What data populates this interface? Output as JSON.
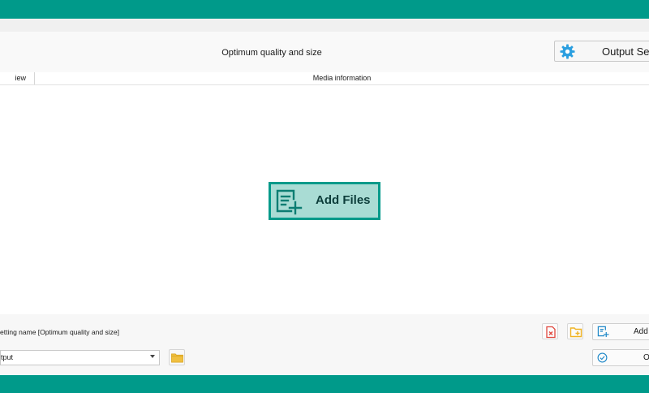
{
  "header": {
    "preset_label": "Optimum quality and size",
    "output_settings_label": "Output Setti"
  },
  "columns": {
    "preview": "iew",
    "media_info": "Media information"
  },
  "main": {
    "add_files_label": "Add Files"
  },
  "footer": {
    "setting_name": "etting name [Optimum quality and size]",
    "add_files_small_label": "Add F",
    "output_folder_value": "tput",
    "ok_label": "Ol"
  },
  "icons": {
    "output_settings": "gear-icon",
    "add_files": "add-file-icon",
    "delete": "delete-file-icon",
    "add_folder": "add-folder-icon",
    "browse": "folder-icon",
    "ok": "check-circle-icon",
    "dropdown": "chevron-down-icon"
  },
  "colors": {
    "accent": "#009a8a",
    "add_files_fill": "#a9dcd4",
    "add_files_text": "#0c3d3a",
    "gear": "#2b9fe0",
    "delete": "#e0483e",
    "folder": "#f0b323"
  }
}
